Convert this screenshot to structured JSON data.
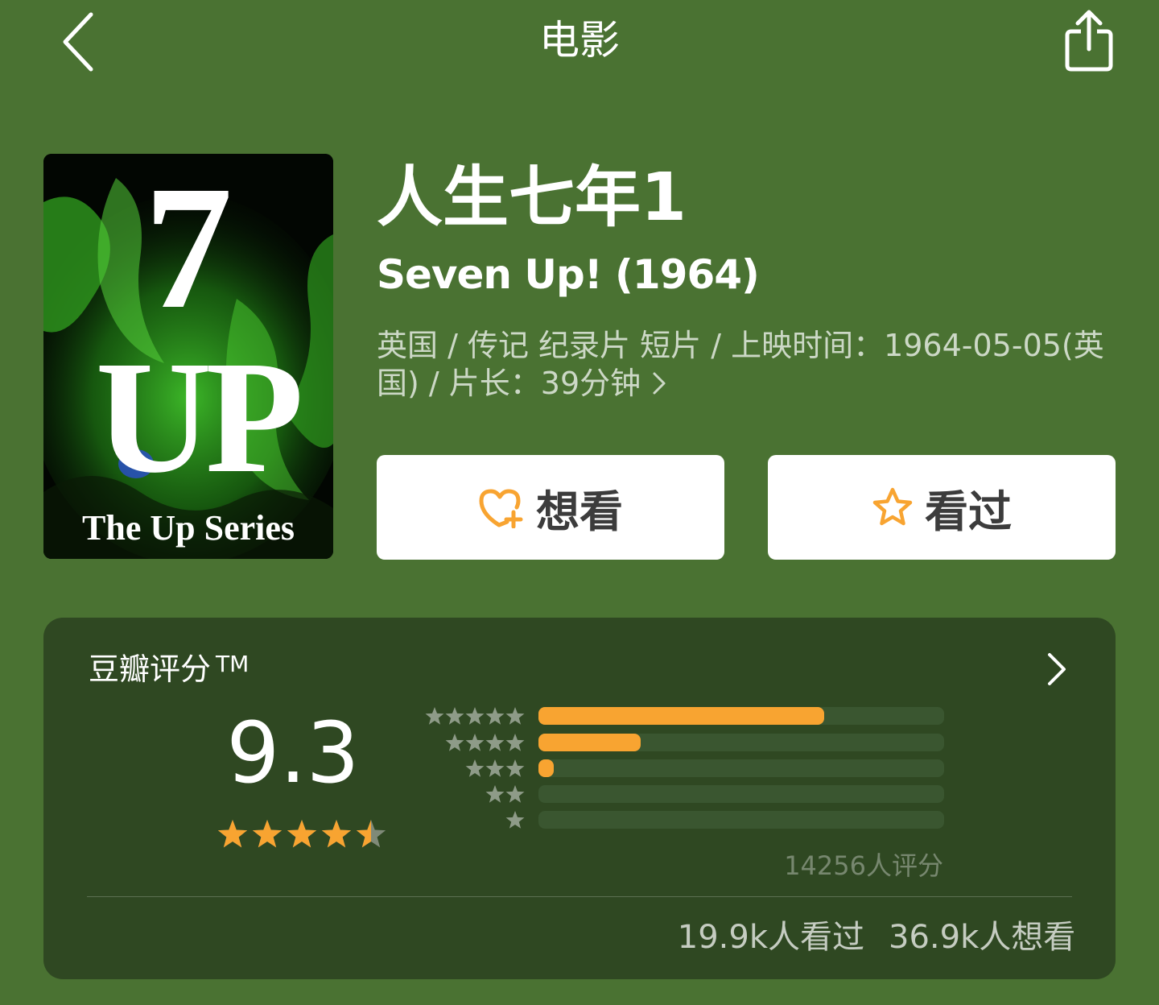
{
  "header": {
    "title": "电影",
    "back_icon": "chevron-left-icon",
    "share_icon": "share-icon"
  },
  "poster": {
    "number": "7",
    "word": "UP",
    "series": "The Up Series"
  },
  "movie": {
    "title_zh": "人生七年1",
    "title_en": "Seven Up! (1964)",
    "meta": "英国 / 传记 纪录片 短片 / 上映时间：1964-05-05(英国) / 片长：39分钟"
  },
  "actions": {
    "wish_label": "想看",
    "wish_icon": "heart-plus-icon",
    "seen_label": "看过",
    "seen_icon": "star-outline-icon",
    "accent_color": "#f8a431"
  },
  "rating": {
    "label": "豆瓣评分",
    "tm": "TM",
    "score": "9.3",
    "stars": 4.5,
    "distribution": [
      {
        "stars": 5,
        "fraction": 0.705
      },
      {
        "stars": 4,
        "fraction": 0.252
      },
      {
        "stars": 3,
        "fraction": 0.037
      },
      {
        "stars": 2,
        "fraction": 0.0
      },
      {
        "stars": 1,
        "fraction": 0.0
      }
    ],
    "count_text": "14256人评分",
    "seen_text": "19.9k人看过",
    "wish_text": "36.9k人想看",
    "bar_color": "#f8a431",
    "bar_track_color": "#3a5630"
  },
  "colors": {
    "background": "#4a7232",
    "card": "#2f4822"
  }
}
